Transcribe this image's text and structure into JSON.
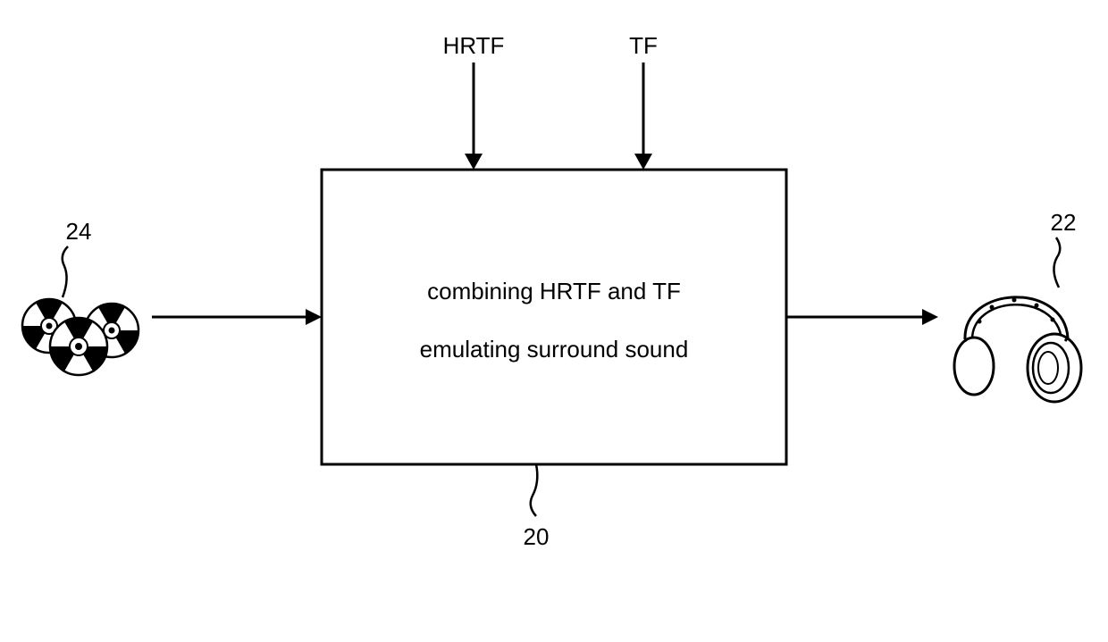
{
  "inputs": {
    "top1": "HRTF",
    "top2": "TF"
  },
  "box": {
    "line1": "combining HRTF and TF",
    "line2": "emulating surround sound"
  },
  "refs": {
    "source": "24",
    "box": "20",
    "headphones": "22"
  }
}
